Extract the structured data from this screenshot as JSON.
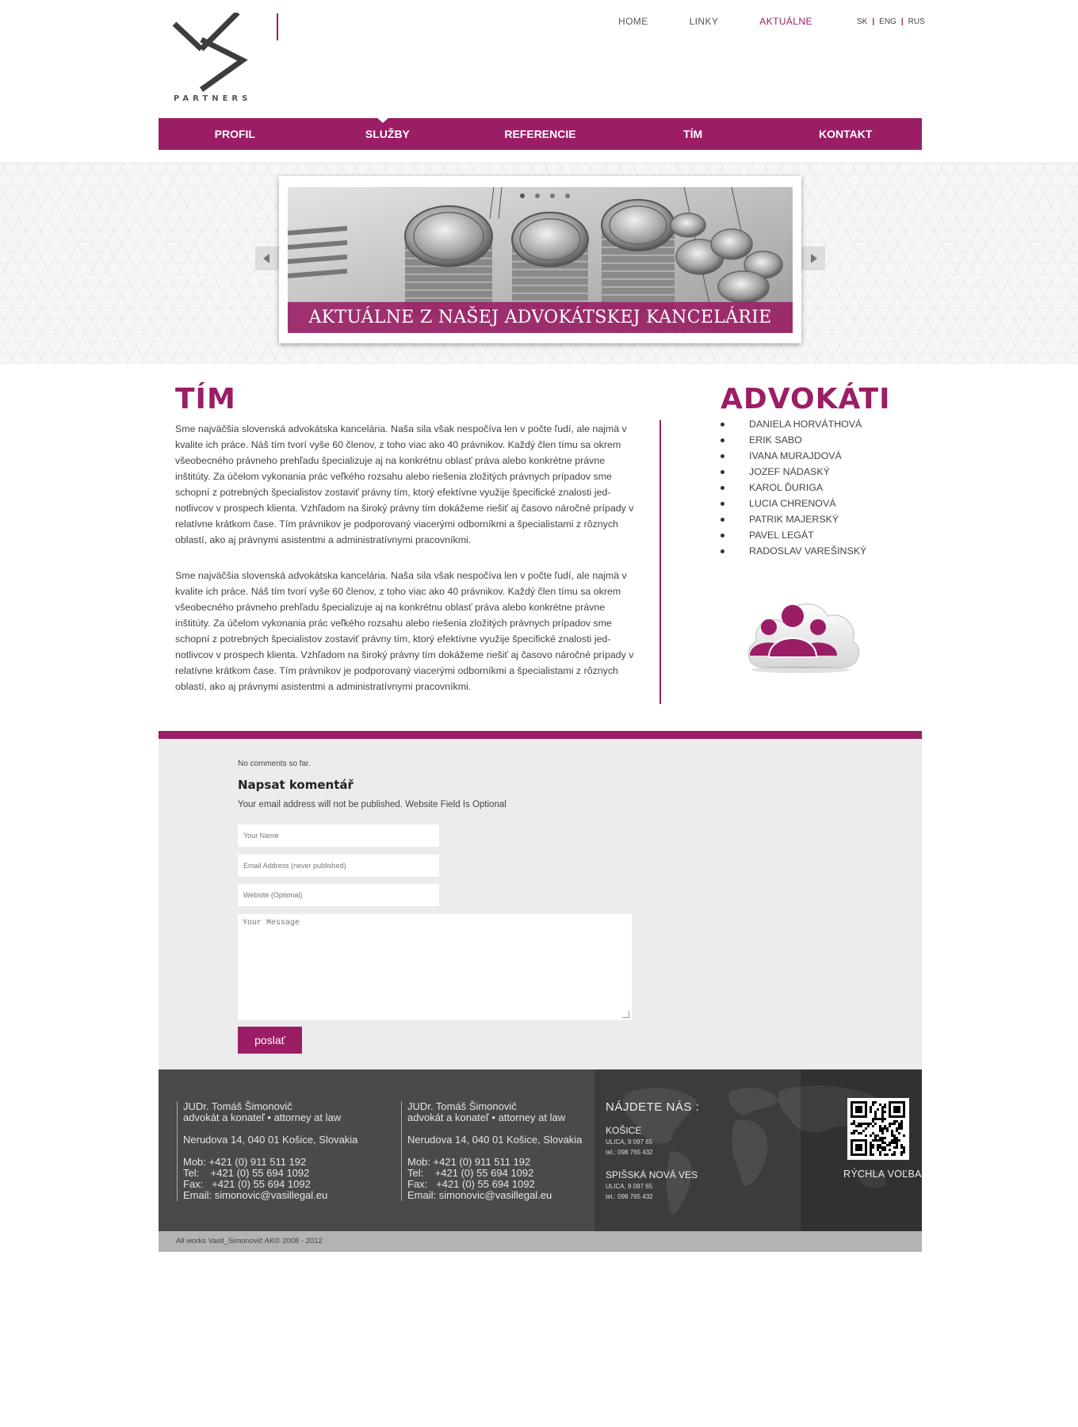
{
  "header": {
    "logo_text": "PARTNERS",
    "top_nav": [
      {
        "label": "HOME",
        "active": false
      },
      {
        "label": "LINKY",
        "active": false
      },
      {
        "label": "AKTUÁLNE",
        "active": true
      }
    ],
    "languages": [
      "SK",
      "ENG",
      "RUS"
    ]
  },
  "main_nav": [
    {
      "label": "PROFIL"
    },
    {
      "label": "SLUŽBY",
      "active": true
    },
    {
      "label": "REFERENCIE"
    },
    {
      "label": "TÍM"
    },
    {
      "label": "KONTAKT"
    }
  ],
  "slider": {
    "caption": "AKTUÁLNE Z NAŠEJ ADVOKÁTSKEJ KANCELÁRIE",
    "dots": 4,
    "active_dot": 0,
    "image_icon": "coins-photo"
  },
  "team": {
    "title": "TÍM",
    "paragraphs": [
      "Sme najväčšia slovenská advokátska kancelária. Naša sila však nespočíva len v počte ľudí, ale najmä v kvalite ich práce. Náš tím tvorí vyše 60 členov, z toho viac ako 40 právnikov. Každý člen tímu sa okrem všeobecného právneho prehľadu špecializuje aj na konkrétnu oblasť práva alebo konkrétne právne inštitúty. Za účelom vykonania prác veľkého rozsahu alebo riešenia zložitých právnych prípadov sme schopní z potrebných špecialistov zostaviť právny tím, ktorý efektívne využije špecifické znalosti jed-notlivcov v prospech klienta. Vzhľadom na široký právny tím dokážeme riešiť aj časovo náročné prípady v relatívne krátkom čase. Tím právnikov je podporovaný viacerými odborníkmi a špecialistami z rôznych oblastí, ako aj právnymi asistentmi a administratívnymi pracovníkmi.",
      "Sme najväčšia slovenská advokátska kancelária. Naša sila však nespočíva len v počte ľudí, ale najmä v kvalite ich práce. Náš tím tvorí vyše 60 členov, z toho viac ako 40 právnikov. Každý člen tímu sa okrem všeobecného právneho prehľadu špecializuje aj na konkrétnu oblasť práva alebo konkrétne právne inštitúty. Za účelom vykonania prác veľkého rozsahu alebo riešenia zložitých právnych prípadov sme schopní z potrebných špecialistov zostaviť právny tím, ktorý efektívne využije špecifické znalosti jed-notlivcov v prospech klienta. Vzhľadom na široký právny tím dokážeme riešiť aj časovo náročné prípady v relatívne krátkom čase. Tím právnikov je podporovaný viacerými odborníkmi a špecialistami z rôznych oblastí, ako aj právnymi asistentmi a administratívnymi pracovníkmi."
    ]
  },
  "lawyers": {
    "title": "ADVOKÁTI",
    "names": [
      "DANIELA HORVÁTHOVÁ",
      "ERIK SABO",
      "IVANA MURAJDOVÁ",
      "JOZEF NÁDASKÝ",
      "KAROL ĎURIGA",
      "LUCIA CHRENOVÁ",
      "PATRIK MAJERSKÝ",
      "PAVEL LEGÁT",
      "RADOSLAV VAREŠINSKÝ"
    ],
    "icon": "team-cloud-icon"
  },
  "comments": {
    "no_comments": "No comments so far.",
    "heading": "Napsat komentář",
    "note": "Your email address will not be published. Website Field Is Optional",
    "name_placeholder": "Your Name",
    "email_placeholder": "Email Address (never published)",
    "website_placeholder": "Website (Optional)",
    "message_placeholder": "Your Message",
    "send_label": "poslať"
  },
  "footer": {
    "contacts": [
      {
        "name": "JUDr. Tomáš Šimonovič",
        "role": "advokát a konateľ • attorney at law",
        "address": "Nerudova 14, 040 01 Košice, Slovakia",
        "mob": "Mob: +421 (0) 911 511 192",
        "tel": "Tel:    +421 (0) 55 694 1092",
        "fax": "Fax:   +421 (0) 55 694 1092",
        "email": "Email: simonovic@vasillegal.eu"
      },
      {
        "name": "JUDr. Tomáš Šimonovič",
        "role": "advokát a konateľ • attorney at law",
        "address": "Nerudova 14, 040 01 Košice, Slovakia",
        "mob": "Mob: +421 (0) 911 511 192",
        "tel": "Tel:    +421 (0) 55 694 1092",
        "fax": "Fax:   +421 (0) 55 694 1092",
        "email": "Email: simonovic@vasillegal.eu"
      }
    ],
    "find_us": {
      "title": "NÁJDETE NÁS :",
      "locations": [
        {
          "city": "KOŠICE",
          "street": "ULICA, 9 097 65",
          "phone": "tel.: 098 765 432"
        },
        {
          "city": "SPIŠSKÁ NOVÁ VES",
          "street": "ULICA, 9 097 65",
          "phone": "tel.: 098 765 432"
        }
      ]
    },
    "qr_label": "RÝCHLA VOĽBA",
    "copyright": "All works Vasil_Simonovič AK© 2008 - 2012"
  },
  "colors": {
    "accent": "#9b1d65",
    "footer_dark": "#4a4a4c",
    "comments_bg": "#ececec"
  }
}
